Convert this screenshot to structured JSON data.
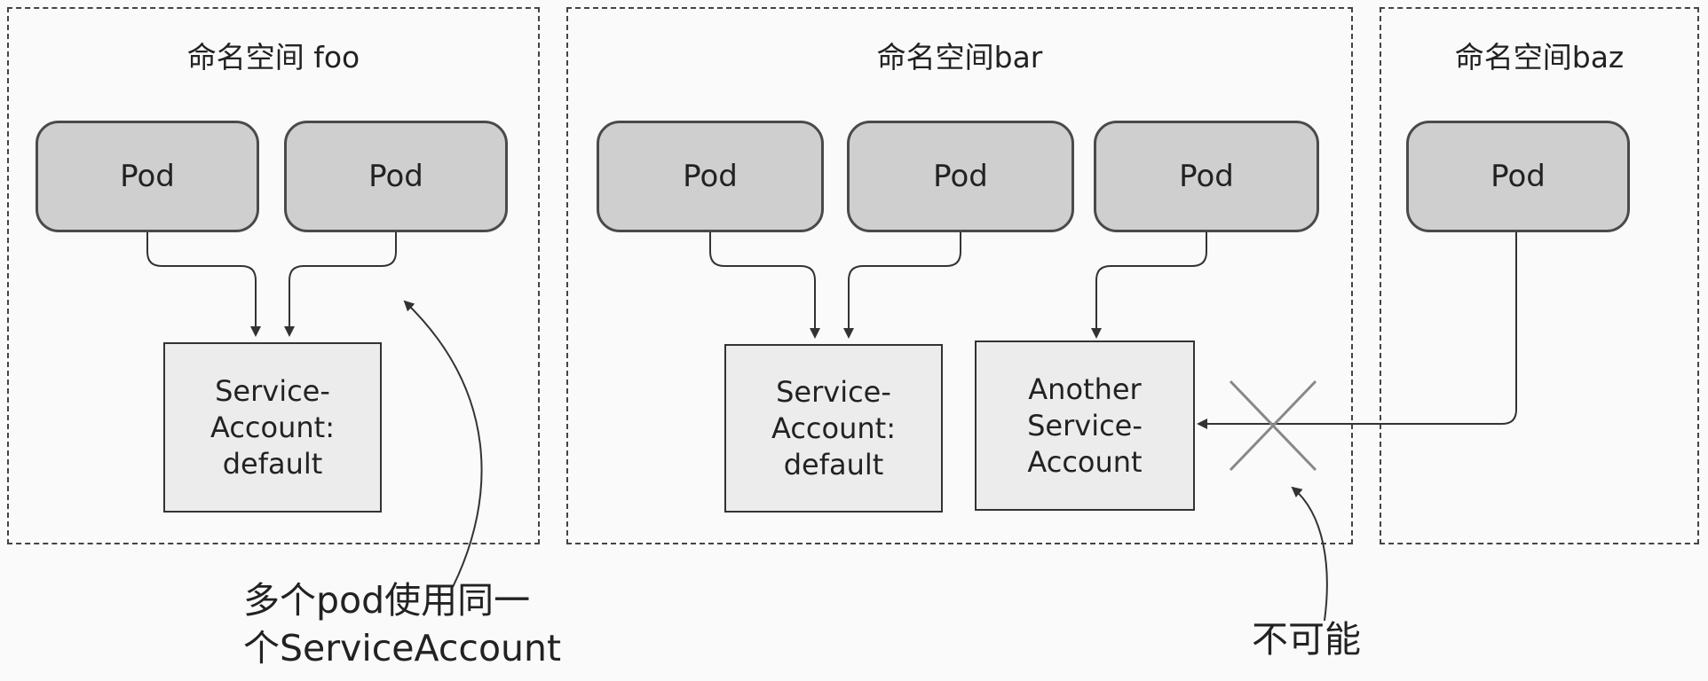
{
  "namespaces": [
    {
      "title": "命名空间 foo"
    },
    {
      "title": "命名空间bar"
    },
    {
      "title": "命名空间baz"
    }
  ],
  "pods": [
    {
      "label": "Pod"
    },
    {
      "label": "Pod"
    },
    {
      "label": "Pod"
    },
    {
      "label": "Pod"
    },
    {
      "label": "Pod"
    },
    {
      "label": "Pod"
    }
  ],
  "service_accounts": [
    {
      "lines": [
        "Service-",
        "Account:",
        "default"
      ]
    },
    {
      "lines": [
        "Service-",
        "Account:",
        "default"
      ]
    },
    {
      "lines": [
        "Another",
        "Service-",
        "Account"
      ]
    }
  ],
  "annotations": {
    "shared_line1": "多个pod使用同一",
    "shared_line2": "个ServiceAccount",
    "impossible": "不可能"
  },
  "colors": {
    "pod_fill": "#cfcfcf",
    "service_account_fill": "#ececec",
    "line": "#333333"
  }
}
